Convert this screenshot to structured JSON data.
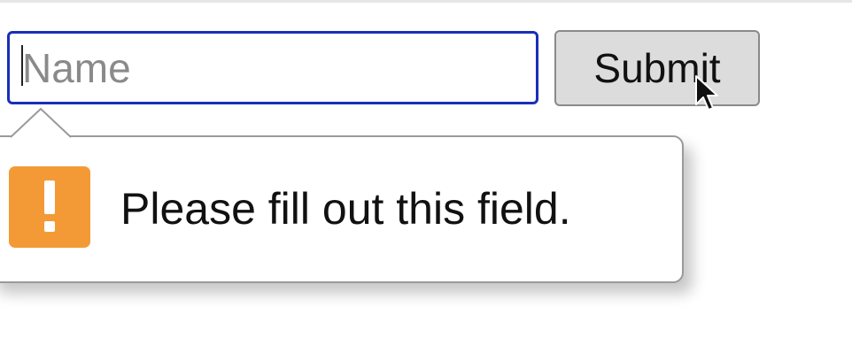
{
  "form": {
    "name_input": {
      "value": "",
      "placeholder": "Name"
    },
    "submit_label": "Submit"
  },
  "validation_tooltip": {
    "icon": "warning-icon",
    "message": "Please fill out this field."
  },
  "colors": {
    "focus_border": "#1a2fb8",
    "button_background": "#dcdcdc",
    "warning_icon": "#f39a36"
  }
}
